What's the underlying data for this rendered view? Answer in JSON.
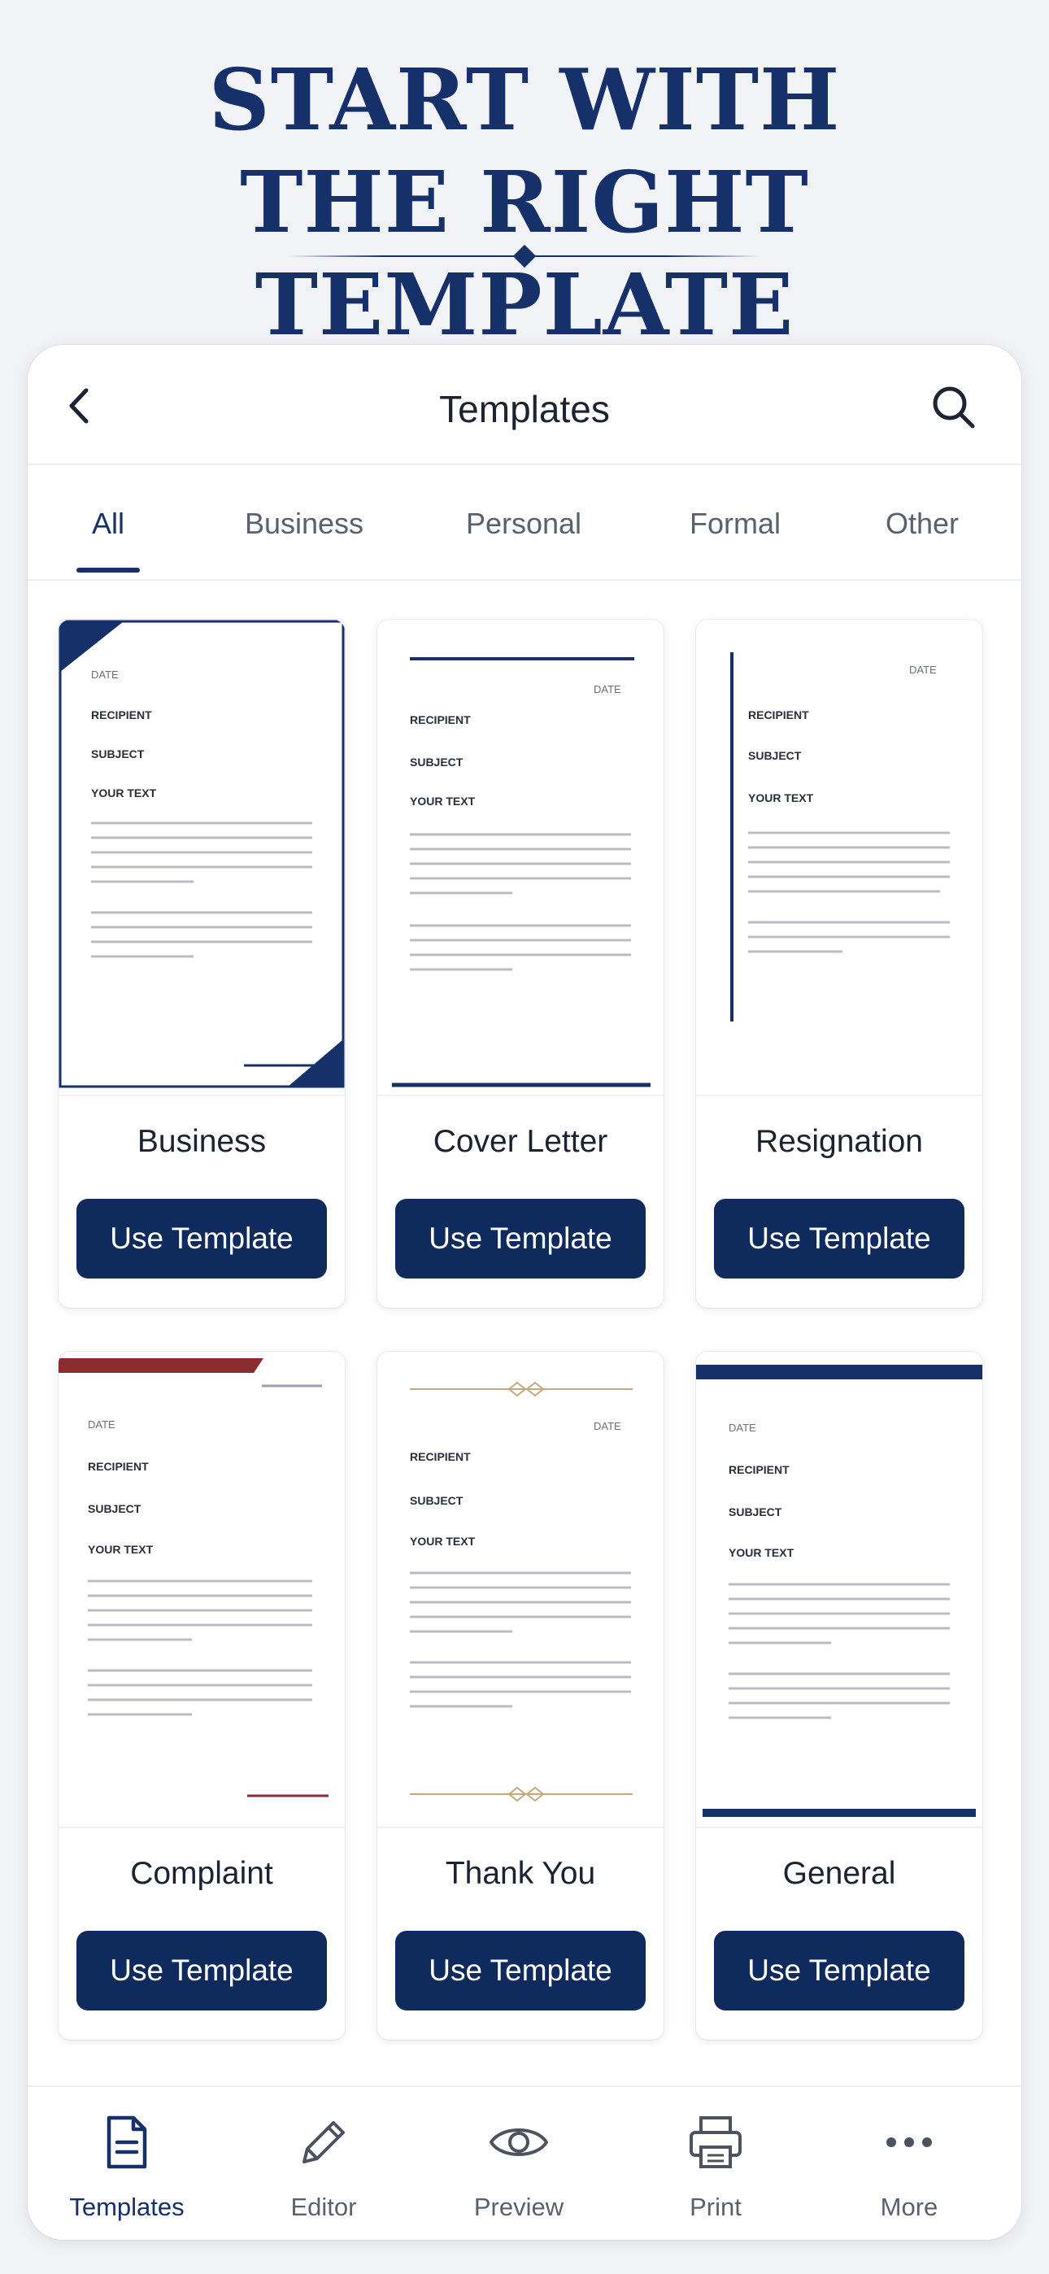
{
  "hero": {
    "title_line1": "START WITH",
    "title_line2": "THE RIGHT TEMPLATE"
  },
  "header": {
    "title": "Templates",
    "back_icon": "chevron-left-icon",
    "search_icon": "search-icon"
  },
  "tabs": [
    {
      "label": "All",
      "active": true
    },
    {
      "label": "Business",
      "active": false
    },
    {
      "label": "Personal",
      "active": false
    },
    {
      "label": "Formal",
      "active": false
    },
    {
      "label": "Other",
      "active": false
    }
  ],
  "preview_fields": {
    "date": "DATE",
    "recipient": "RECIPIENT",
    "subject": "SUBJECT",
    "your_text": "YOUR TEXT"
  },
  "templates": [
    {
      "name": "Business",
      "button": "Use Template"
    },
    {
      "name": "Cover Letter",
      "button": "Use Template"
    },
    {
      "name": "Resignation",
      "button": "Use Template"
    },
    {
      "name": "Complaint",
      "button": "Use Template"
    },
    {
      "name": "Thank You",
      "button": "Use Template"
    },
    {
      "name": "General",
      "button": "Use Template"
    }
  ],
  "bottom_nav": [
    {
      "label": "Templates",
      "icon": "document-icon",
      "active": true
    },
    {
      "label": "Editor",
      "icon": "pencil-icon",
      "active": false
    },
    {
      "label": "Preview",
      "icon": "eye-icon",
      "active": false
    },
    {
      "label": "Print",
      "icon": "printer-icon",
      "active": false
    },
    {
      "label": "More",
      "icon": "more-dots-icon",
      "active": false
    }
  ],
  "colors": {
    "brand_navy": "#16306a",
    "button_navy": "#0f2b5e",
    "accent_red": "#8b2c2f",
    "accent_gold": "#c4a880",
    "background": "#f2f3f6"
  }
}
